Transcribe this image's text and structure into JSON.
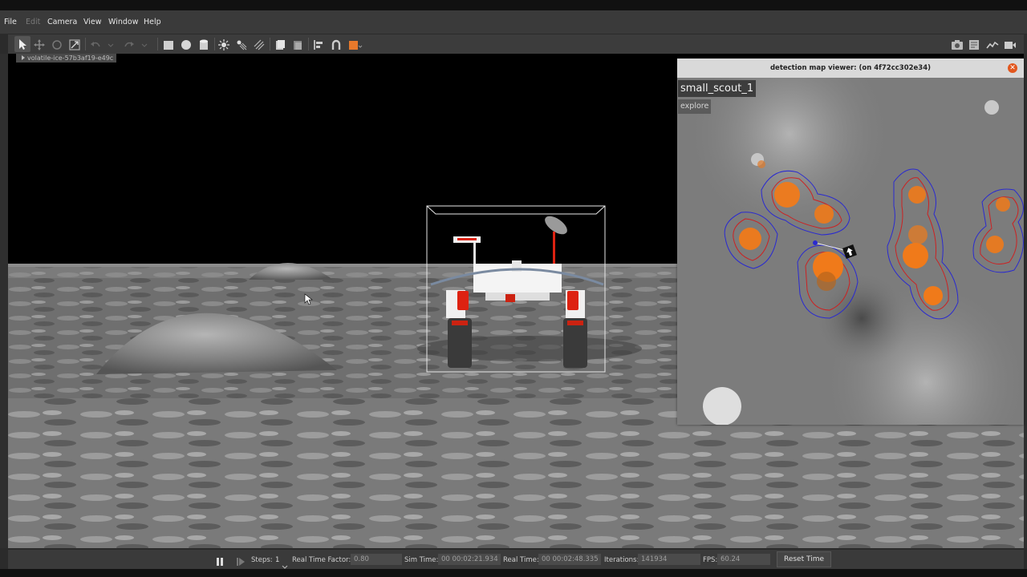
{
  "menu": [
    {
      "label": "File",
      "enabled": true
    },
    {
      "label": "Edit",
      "enabled": false
    },
    {
      "label": "Camera",
      "enabled": true
    },
    {
      "label": "View",
      "enabled": true
    },
    {
      "label": "Window",
      "enabled": true
    },
    {
      "label": "Help",
      "enabled": true
    }
  ],
  "toolbar": {
    "left_icons": [
      "select-arrow-icon",
      "translate-icon",
      "rotate-icon",
      "scale-icon",
      "undo-icon",
      "undo-history-icon",
      "redo-icon",
      "redo-history-icon",
      "box-shape-icon",
      "sphere-shape-icon",
      "cylinder-shape-icon",
      "point-light-icon",
      "spot-light-icon",
      "directional-light-icon",
      "copy-icon",
      "paste-icon",
      "align-icon",
      "snap-icon",
      "view-angle-icon"
    ],
    "right_icons": [
      "screenshot-icon",
      "log-icon",
      "plot-icon",
      "video-icon"
    ],
    "accent": "#e8792b"
  },
  "tree": {
    "selected": "volatile-ice-57b3af19-e49c"
  },
  "map_viewer": {
    "title": "detection map viewer: (on 4f72cc302e34)",
    "robot_name": "small_scout_1",
    "robot_state": "explore",
    "colors": {
      "volatile": "#f07a1a",
      "outer_contour": "#2a2ad0",
      "inner_contour": "#cc2222"
    }
  },
  "status": {
    "steps_label": "Steps:",
    "steps_value": "1",
    "rtf_label": "Real Time Factor:",
    "rtf_value": "0.80",
    "sim_time_label": "Sim Time:",
    "sim_time_value": "00 00:02:21.934",
    "real_time_label": "Real Time:",
    "real_time_value": "00 00:02:48.335",
    "iterations_label": "Iterations:",
    "iterations_value": "141934",
    "fps_label": "FPS:",
    "fps_value": "60.24",
    "reset_label": "Reset Time"
  }
}
